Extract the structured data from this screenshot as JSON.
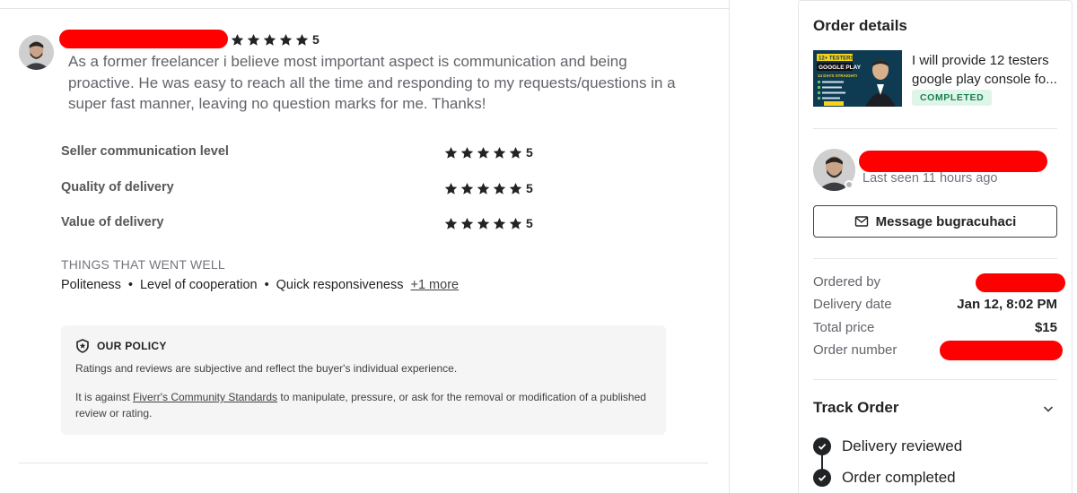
{
  "review": {
    "rating": "5",
    "text": "As a former freelancer i believe most important aspect is communication and being proactive. He was easy to reach all the time and responding to my requests/questions in a super fast manner, leaving no question marks for me. Thanks!",
    "breakdown": [
      {
        "label": "Seller communication level",
        "score": "5"
      },
      {
        "label": "Quality of delivery",
        "score": "5"
      },
      {
        "label": "Value of delivery",
        "score": "5"
      }
    ],
    "went_well_title": "THINGS THAT WENT WELL",
    "went_well": [
      "Politeness",
      "Level of cooperation",
      "Quick responsiveness"
    ],
    "more_link": "+1 more",
    "bullet": "•"
  },
  "policy": {
    "title": "OUR POLICY",
    "p1": "Ratings and reviews are subjective and reflect the buyer's individual experience.",
    "p2_before": "It is against ",
    "p2_link": "Fiverr's Community Standards",
    "p2_after": " to manipulate, pressure, or ask for the removal or modification of a published review or rating."
  },
  "sidebar": {
    "title": "Order details",
    "gig": {
      "title": "I will provide 12 testers google play console fo...",
      "status": "COMPLETED",
      "thumb_lines": [
        "12+ TESTERS",
        "GOOGLE PLAY",
        "14 DAYS STRAIGHT!"
      ]
    },
    "seller": {
      "last_seen": "Last seen 11 hours ago",
      "message_button": "Message bugracuhaci"
    },
    "details": [
      {
        "label": "Ordered by",
        "value": ""
      },
      {
        "label": "Delivery date",
        "value": "Jan 12, 8:02 PM"
      },
      {
        "label": "Total price",
        "value": "$15"
      },
      {
        "label": "Order number",
        "value": ""
      }
    ],
    "track": {
      "title": "Track Order",
      "steps": [
        "Delivery reviewed",
        "Order completed"
      ]
    }
  },
  "colors": {
    "redaction": "#ff0000",
    "badge_bg": "#e0f5ea",
    "badge_text": "#1a7f4f",
    "text_dark": "#222325"
  }
}
